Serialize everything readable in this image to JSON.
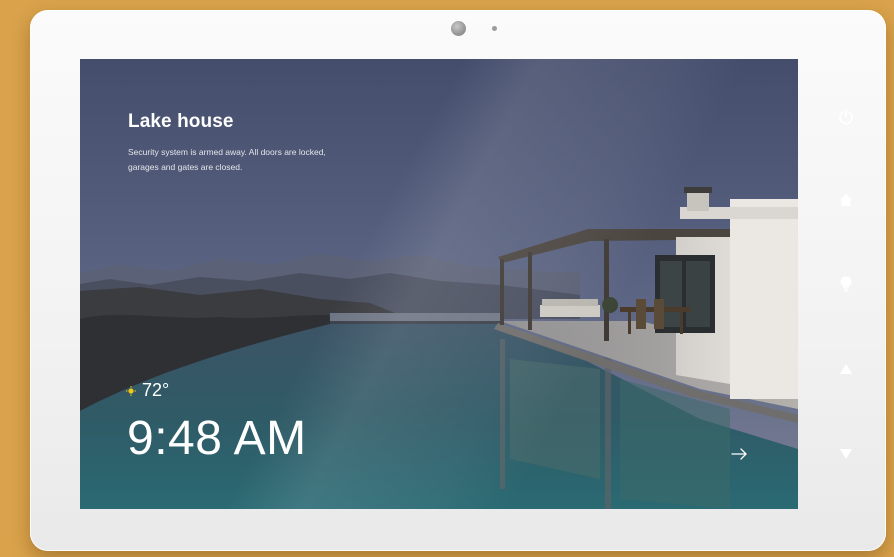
{
  "screen": {
    "title": "Lake house",
    "description": "Security system is armed away. All doors are locked, garages and gates are closed.",
    "weather": {
      "icon": "sun-icon",
      "temperature": "72°"
    },
    "time": "9:48 AM",
    "next_icon": "arrow-right-icon"
  },
  "side_buttons": [
    {
      "icon": "power-icon"
    },
    {
      "icon": "home-icon"
    },
    {
      "icon": "lightbulb-icon"
    },
    {
      "icon": "arrow-up-icon"
    },
    {
      "icon": "arrow-down-icon"
    }
  ],
  "colors": {
    "background": "#d9a24b",
    "bezel": "#f4f4f4",
    "accent_sun": "#f5c518",
    "text": "#ffffff"
  }
}
